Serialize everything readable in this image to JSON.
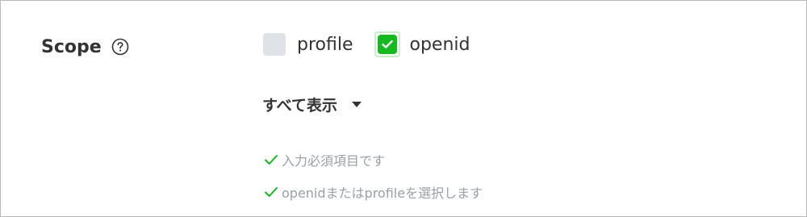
{
  "field": {
    "label": "Scope",
    "help_icon": "question-circle-icon"
  },
  "options": [
    {
      "label": "profile",
      "checked": false
    },
    {
      "label": "openid",
      "checked": true
    }
  ],
  "show_all": {
    "label": "すべて表示",
    "icon": "caret-down-icon"
  },
  "hints": [
    {
      "text": "入力必須項目です",
      "icon": "check-icon"
    },
    {
      "text": "openidまたはprofileを選択します",
      "icon": "check-icon"
    }
  ],
  "colors": {
    "check_green": "#16b91f",
    "unchecked_gray": "#dfe2e6",
    "hint_gray": "#9aa0a6",
    "text_dark": "#333333"
  }
}
